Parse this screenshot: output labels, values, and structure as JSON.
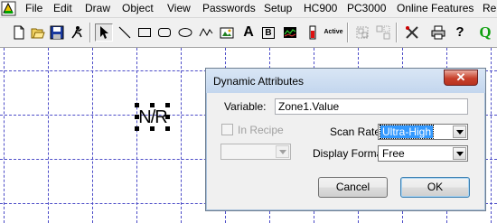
{
  "menu": {
    "items": [
      "File",
      "Edit",
      "Draw",
      "Object",
      "View",
      "Passwords",
      "Setup",
      "HC900",
      "PC3000",
      "Online Features",
      "Re"
    ]
  },
  "toolbar": {
    "buttons": [
      "new-icon",
      "open-icon",
      "save-icon",
      "run-icon",
      "select-arrow-icon",
      "line-icon",
      "rectangle-icon",
      "rounded-rectangle-icon",
      "ellipse-icon",
      "polyline-icon",
      "bitmap-icon",
      "text-icon",
      "button-icon",
      "trend-icon",
      "bargraph-icon",
      "active-icon",
      "group-icon",
      "ungroup-icon",
      "tools-icon",
      "print-icon",
      "help-icon",
      "q-icon"
    ],
    "text_tool_label": "A",
    "button_tool_label": "B",
    "active_tool_label": "Active",
    "help_label": "?",
    "q_label": "Q"
  },
  "canvas": {
    "object_text": "N/R",
    "grid_color": "#4c4cc8"
  },
  "dialog": {
    "title": "Dynamic Attributes",
    "close_glyph": "✕",
    "variable_label": "Variable:",
    "variable_value": "Zone1.Value",
    "in_recipe_label": "In Recipe",
    "scan_rate_label": "Scan Rate:",
    "scan_rate_value": "Ultra-High",
    "display_format_label": "Display Format:",
    "display_format_value": "Free",
    "cancel_label": "Cancel",
    "ok_label": "OK"
  },
  "colors": {
    "selection_highlight": "#3399ff",
    "close_button": "#c7402b"
  }
}
